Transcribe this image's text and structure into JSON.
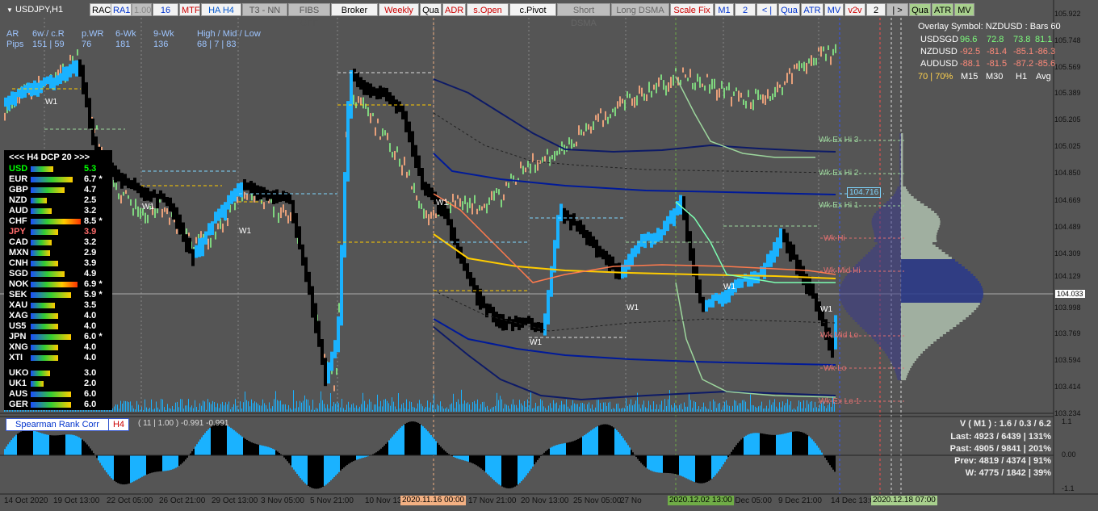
{
  "symbol": "USDJPY,H1",
  "toolbar": [
    "RAC",
    "RA1",
    "1.00",
    "16",
    "MTF",
    "HA H4",
    "T3 - NN",
    "FIBS OFF",
    "Broker",
    "Weekly",
    "Qua",
    "ADR",
    "s.Open",
    "c.Pivot",
    "Short DSMA",
    "Long DSMA",
    "Scale Fix",
    "M1",
    "2",
    "< |",
    "Qua",
    "ATR",
    "MV",
    "v2v",
    "2",
    "| >",
    "Qua",
    "ATR",
    "MV"
  ],
  "stats": {
    "col1": "AR\nPips",
    "col2": "6w / c.R\n151 | 59",
    "col3": "p.WR\n76",
    "col4": "6-Wk\n181",
    "col5": "9-Wk\n136",
    "col6": "High / Mid / Low\n68 | 7 | 83"
  },
  "overlay": {
    "title": "Overlay Symbol: NZDUSD : Bars 60",
    "rows": [
      {
        "sym": "USDSGD",
        "v": [
          "96.6",
          "72.8",
          "73.8",
          "81.1"
        ]
      },
      {
        "sym": "NZDUSD",
        "v": [
          "-92.5",
          "-81.4",
          "-85.1",
          "-86.3"
        ]
      },
      {
        "sym": "AUDUSD",
        "v": [
          "-88.1",
          "-81.5",
          "-87.2",
          "-85.6"
        ]
      }
    ],
    "footer": [
      "70 | 70%",
      "M15",
      "M30",
      "H1",
      "Avg"
    ]
  },
  "dcp": {
    "header": "<<<  H4  DCP 20    >>>",
    "rows": [
      {
        "code": "USD",
        "val": "5.3",
        "color": "#00ff00"
      },
      {
        "code": "EUR",
        "val": "6.7 *",
        "color": "#ffffff"
      },
      {
        "code": "GBP",
        "val": "4.7",
        "color": "#ffffff"
      },
      {
        "code": "NZD",
        "val": "2.5",
        "color": "#ffffff"
      },
      {
        "code": "AUD",
        "val": "3.2",
        "color": "#ffffff"
      },
      {
        "code": "CHF",
        "val": "8.5 *",
        "color": "#ffffff"
      },
      {
        "code": "JPY",
        "val": "3.9",
        "color": "#ff6b6b"
      },
      {
        "code": "CAD",
        "val": "3.2",
        "color": "#ffffff"
      },
      {
        "code": "MXN",
        "val": "2.9",
        "color": "#ffffff"
      },
      {
        "code": "CNH",
        "val": "3.9",
        "color": "#ffffff"
      },
      {
        "code": "SGD",
        "val": "4.9",
        "color": "#ffffff"
      },
      {
        "code": "NOK",
        "val": "6.9 *",
        "color": "#ffffff"
      },
      {
        "code": "SEK",
        "val": "5.9 *",
        "color": "#ffffff"
      },
      {
        "code": "XAU",
        "val": "3.5",
        "color": "#ffffff"
      },
      {
        "code": "XAG",
        "val": "4.0",
        "color": "#ffffff"
      },
      {
        "code": "US5",
        "val": "4.0",
        "color": "#ffffff"
      },
      {
        "code": "JPN",
        "val": "6.0 *",
        "color": "#ffffff"
      },
      {
        "code": "XNG",
        "val": "4.0",
        "color": "#ffffff"
      },
      {
        "code": "XTI",
        "val": "4.0",
        "color": "#ffffff"
      },
      {
        "code": "UKO",
        "val": "3.0",
        "color": "#ffffff"
      },
      {
        "code": "UK1",
        "val": "2.0",
        "color": "#ffffff"
      },
      {
        "code": "AUS",
        "val": "6.0",
        "color": "#ffffff"
      },
      {
        "code": "GER",
        "val": "6.0",
        "color": "#ffffff"
      }
    ]
  },
  "levels": [
    "Wk Ex Hi 3",
    "Wk Ex Hi 2",
    "Wk Ex Hi 1",
    "Wk Hi",
    "Wk Mid Hi",
    "Wk Mid Lo",
    "Wk Lo",
    "Wk Ex Lo 1",
    "W1"
  ],
  "price_scale": [
    "105.922",
    "105.748",
    "105.569",
    "105.389",
    "105.205",
    "105.025",
    "104.850",
    "104.669",
    "104.489",
    "104.309",
    "104.129",
    "103.998",
    "103.769",
    "103.594",
    "103.414",
    "103.234"
  ],
  "price_tags": {
    "current": "104.033",
    "dsma": "104.716"
  },
  "time_scale": [
    "14 Oct 2020",
    "19 Oct 13:00",
    "22 Oct 05:00",
    "26 Oct 21:00",
    "29 Oct 13:00",
    "3 Nov 05:00",
    "5 Nov 21:00",
    "10 Nov 13:00",
    "17 Nov 21:00",
    "20 Nov 13:00",
    "25 Nov 05:00",
    "27 No",
    "7 Dec 05:00",
    "9 Dec 21:00",
    "14 Dec 13:00"
  ],
  "time_marks": [
    "2020.11.16 00:00",
    "2020.12.02 13:00",
    "2020.12.18 07:00"
  ],
  "subwindow": {
    "name": "Spearman Rank Corr",
    "tf": "H4",
    "params": "( 11 | 1.00 ) -0.991 -0.991",
    "scale": [
      "1.1",
      "0.00",
      "-1.1"
    ]
  },
  "volume_box": [
    "V ( M1 ) : 1.6 / 0.3 / 6.2",
    "Last: 4923 / 6439 | 131%",
    "Past: 4905 / 9841 | 201%",
    "Prev: 4819 / 4374 | 91%",
    "W: 4775 / 1842 | 39%"
  ],
  "colors": {
    "bg": "#555555",
    "ha_up": "#1ab2ff",
    "ha_down": "#000000",
    "bull": "#7fd67f",
    "bear": "#e8a07a",
    "dsma": "#001a99",
    "orange": "#ff9a1a"
  }
}
